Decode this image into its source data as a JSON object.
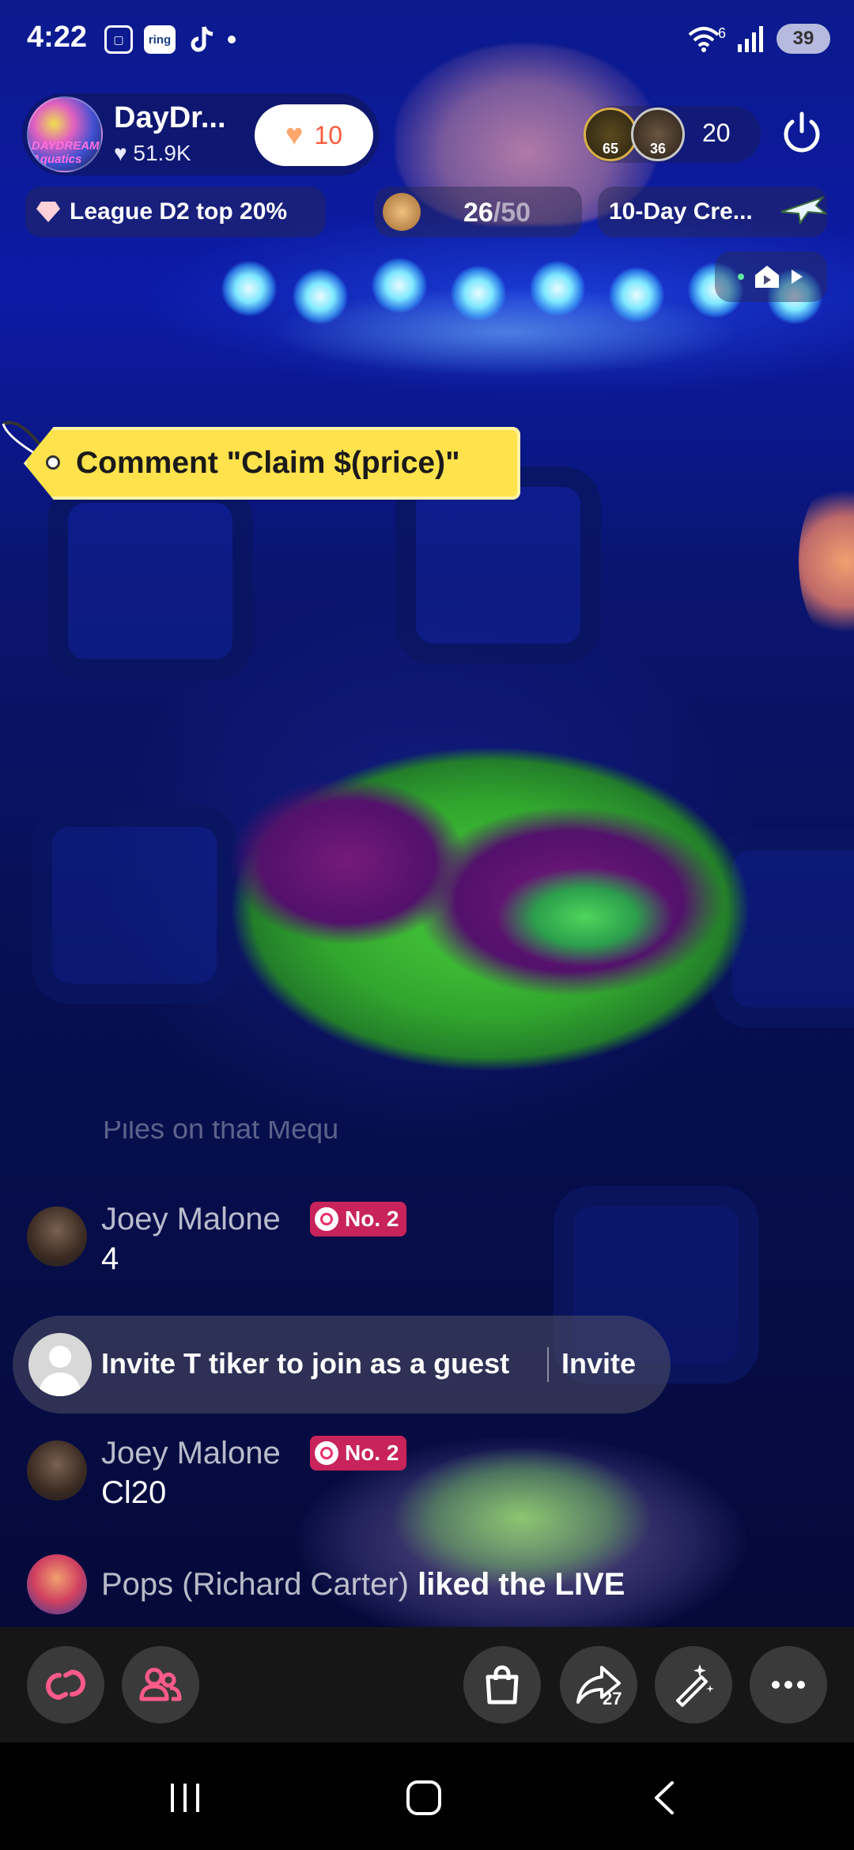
{
  "status_bar": {
    "time": "4:22",
    "ring_label": "ring",
    "battery": "39",
    "wifi_label": "6"
  },
  "host": {
    "name": "DayDr...",
    "likes": "51.9K",
    "avatar_text": "DAYDREAM Aquatics",
    "follow_count": "10"
  },
  "viewers": {
    "avatar_1_level": "65",
    "avatar_2_level": "36",
    "count": "20"
  },
  "chips": {
    "league": "League D2 top 20%",
    "goal_current": "26",
    "goal_total": "/50",
    "challenge": "10-Day Cre..."
  },
  "price_tag": {
    "label": "Comment \"Claim $(price)\""
  },
  "chat": {
    "faded_line": "Piles on that Mequ",
    "messages": [
      {
        "name": "Joey Malone",
        "badge": "No. 2",
        "text": "4"
      },
      {
        "name": "Joey Malone",
        "badge": "No. 2",
        "text": "Cl20"
      }
    ],
    "invite": {
      "text": "Invite T tiker to join as a guest",
      "button": "Invite"
    },
    "activity": {
      "name": "Pops (Richard Carter)",
      "action": "liked the LIVE"
    }
  },
  "toolbar": {
    "share_count": "27"
  },
  "colors": {
    "accent_pink": "#ff5a8a",
    "badge_red": "#c8235a",
    "tag_yellow": "#ffe24c",
    "follow_heart": "#ffa66a"
  },
  "icons": {
    "toolbar": [
      "link-icon",
      "guests-icon",
      "shopping-bag-icon",
      "share-icon",
      "magic-wand-icon",
      "more-icon"
    ],
    "nav": [
      "recents-icon",
      "home-icon",
      "back-icon"
    ]
  }
}
